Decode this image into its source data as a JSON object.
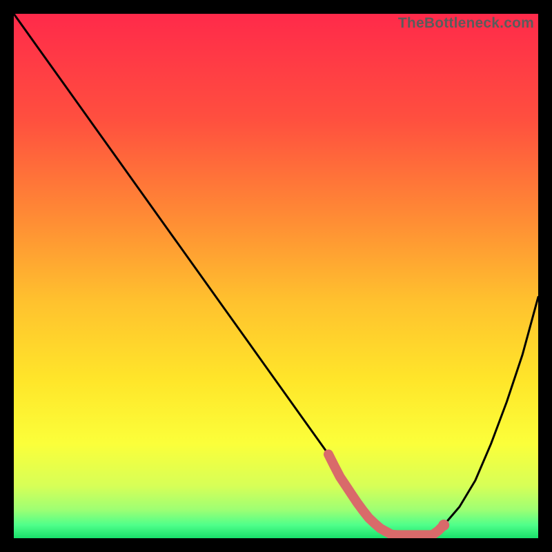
{
  "watermark": "TheBottleneck.com",
  "gradient_stops": [
    {
      "offset": 0.0,
      "color": "#ff2a4a"
    },
    {
      "offset": 0.2,
      "color": "#ff4f3f"
    },
    {
      "offset": 0.4,
      "color": "#ff8f34"
    },
    {
      "offset": 0.55,
      "color": "#ffc22e"
    },
    {
      "offset": 0.7,
      "color": "#ffe62a"
    },
    {
      "offset": 0.82,
      "color": "#fbff3a"
    },
    {
      "offset": 0.9,
      "color": "#d7ff57"
    },
    {
      "offset": 0.945,
      "color": "#9fff73"
    },
    {
      "offset": 0.975,
      "color": "#4fff8a"
    },
    {
      "offset": 1.0,
      "color": "#19e06b"
    }
  ],
  "chart_data": {
    "type": "line",
    "title": "",
    "xlabel": "",
    "ylabel": "",
    "xlim": [
      0,
      100
    ],
    "ylim": [
      0,
      100
    ],
    "x": [
      0,
      5,
      10,
      15,
      20,
      25,
      30,
      35,
      40,
      45,
      50,
      55,
      60,
      62,
      64,
      66,
      68,
      70,
      72,
      74,
      76,
      78,
      80,
      82,
      85,
      88,
      91,
      94,
      97,
      100
    ],
    "y": [
      100,
      93,
      86,
      79,
      72,
      65,
      58,
      51,
      44,
      37,
      30,
      23,
      16,
      12,
      9,
      6,
      3.5,
      1.8,
      0.7,
      0.1,
      0,
      0,
      0.5,
      2.5,
      6,
      11,
      18,
      26,
      35,
      46
    ],
    "grid": false,
    "legend": null,
    "marker_region": {
      "x_start": 60,
      "x_end": 82,
      "y": 0.6
    },
    "marker_dot": {
      "x": 82,
      "y": 1.0
    }
  }
}
